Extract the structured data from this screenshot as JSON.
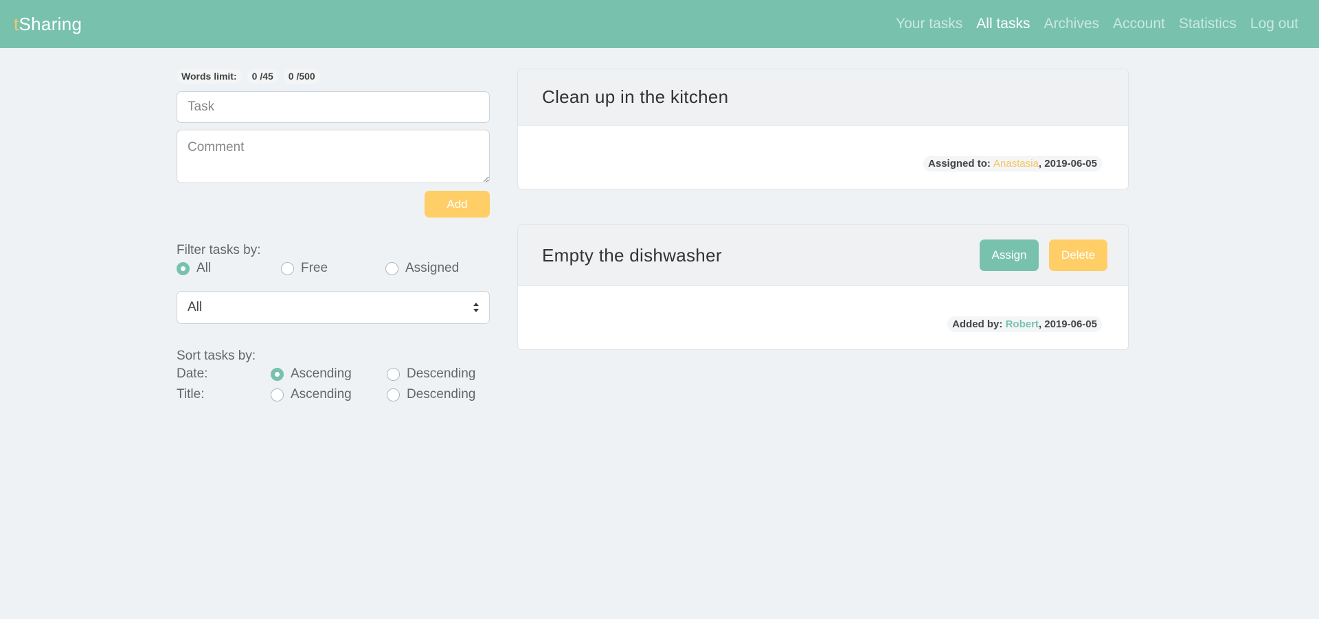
{
  "navbar": {
    "brand_accent": "t",
    "brand_rest": "Sharing",
    "links": [
      {
        "label": "Your tasks",
        "active": false
      },
      {
        "label": "All tasks",
        "active": true
      },
      {
        "label": "Archives",
        "active": false
      },
      {
        "label": "Account",
        "active": false
      },
      {
        "label": "Statistics",
        "active": false
      },
      {
        "label": "Log out",
        "active": false
      }
    ]
  },
  "form": {
    "words_limit_label": "Words limit:",
    "task_count": "0 /45",
    "comment_count": "0 /500",
    "task_placeholder": "Task",
    "comment_placeholder": "Comment",
    "add_label": "Add"
  },
  "filter": {
    "label": "Filter tasks by:",
    "options": [
      {
        "label": "All",
        "checked": true
      },
      {
        "label": "Free",
        "checked": false
      },
      {
        "label": "Assigned",
        "checked": false
      }
    ],
    "select_value": "All"
  },
  "sort": {
    "label": "Sort tasks by:",
    "rows": [
      {
        "label": "Date:",
        "ascending": "Ascending",
        "descending": "Descending",
        "selected": "ascending"
      },
      {
        "label": "Title:",
        "ascending": "Ascending",
        "descending": "Descending",
        "selected": "none"
      }
    ]
  },
  "tasks": [
    {
      "title": "Clean up in the kitchen",
      "meta_label": "Assigned to:",
      "user": "Anastasia",
      "date_text": ", 2019-06-05"
    },
    {
      "title": "Empty the dishwasher",
      "assign_label": "Assign",
      "delete_label": "Delete",
      "meta_label": "Added by:",
      "user": "Robert",
      "date_text": ", 2019-06-05"
    }
  ],
  "colors": {
    "primary": "#78c2ad",
    "warning": "#ffce67",
    "background": "#eff2f4"
  }
}
